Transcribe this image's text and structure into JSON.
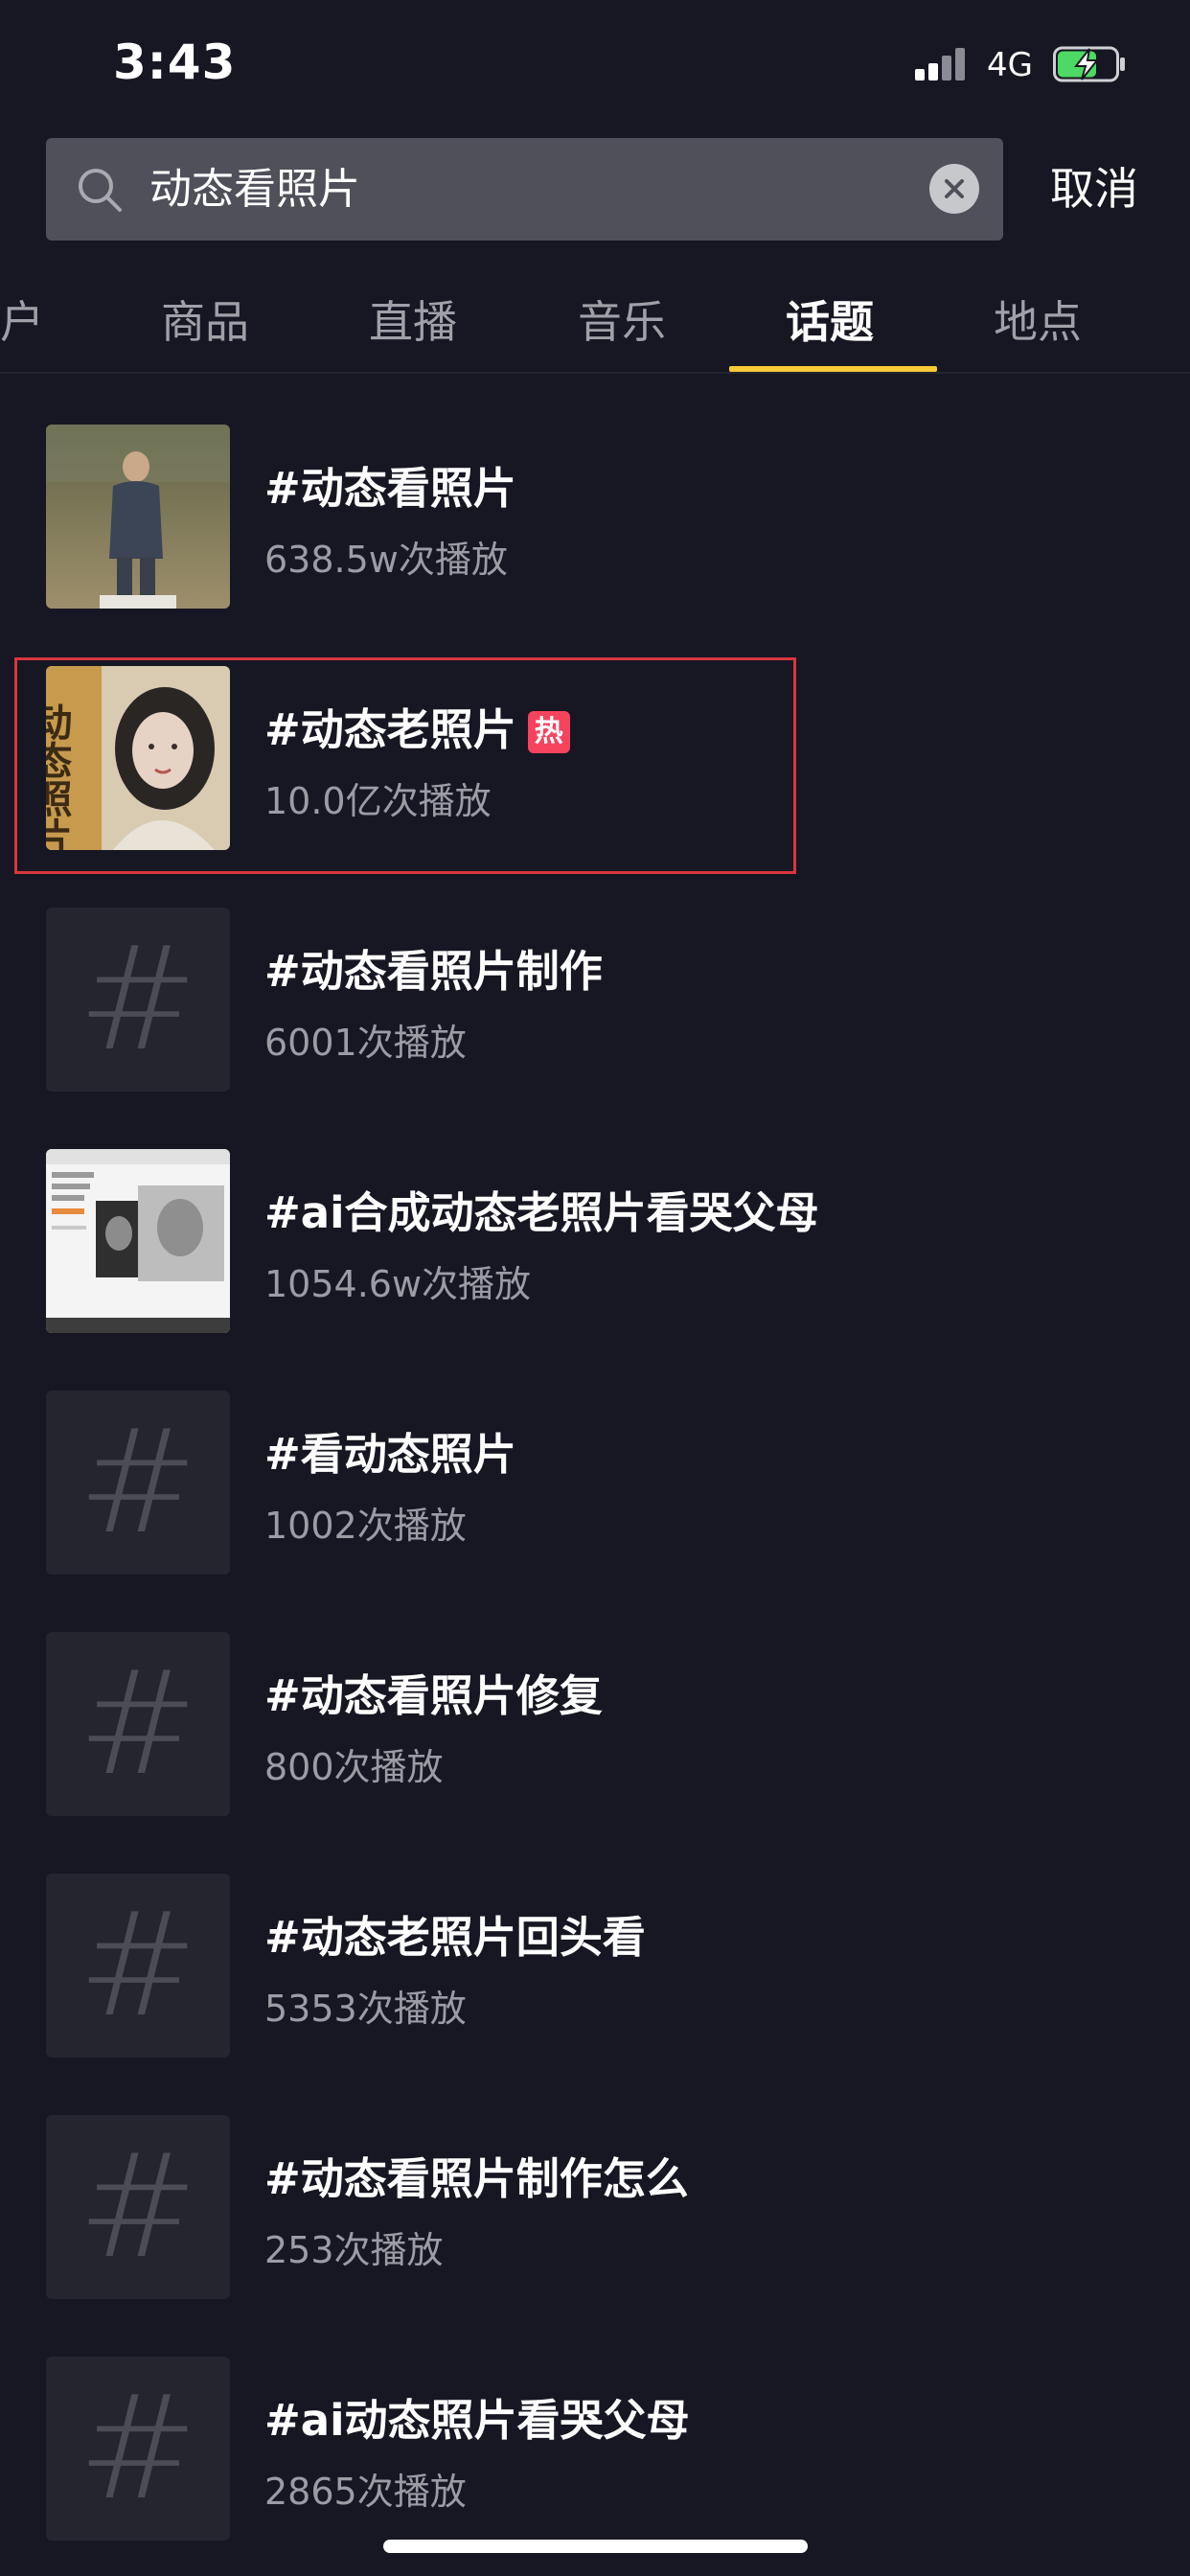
{
  "status_bar": {
    "time": "3:43",
    "network": "4G"
  },
  "search": {
    "value": "动态看照片",
    "cancel_label": "取消"
  },
  "tabs": [
    {
      "label": "户"
    },
    {
      "label": "商品"
    },
    {
      "label": "直播"
    },
    {
      "label": "音乐"
    },
    {
      "label": "话题",
      "active": true
    },
    {
      "label": "地点"
    }
  ],
  "topics": [
    {
      "title": "#动态看照片",
      "plays": "638.5w次播放",
      "thumb": "photo-man"
    },
    {
      "title": "#动态老照片",
      "plays": "10.0亿次播放",
      "thumb": "photo-woman",
      "badge": "热",
      "thumb_text": "动态照片"
    },
    {
      "title": "#动态看照片制作",
      "plays": "6001次播放",
      "thumb": "hash"
    },
    {
      "title": "#ai合成动态老照片看哭父母",
      "plays": "1054.6w次播放",
      "thumb": "screenshot"
    },
    {
      "title": "#看动态照片",
      "plays": "1002次播放",
      "thumb": "hash"
    },
    {
      "title": "#动态看照片修复",
      "plays": "800次播放",
      "thumb": "hash"
    },
    {
      "title": "#动态老照片回头看",
      "plays": "5353次播放",
      "thumb": "hash"
    },
    {
      "title": "#动态看照片制作怎么",
      "plays": "253次播放",
      "thumb": "hash"
    },
    {
      "title": "#ai动态照片看哭父母",
      "plays": "2865次播放",
      "thumb": "hash"
    }
  ],
  "colors": {
    "background": "#161722",
    "accent": "#f7c935",
    "hot": "#f6435d",
    "highlight": "#d9363e"
  }
}
